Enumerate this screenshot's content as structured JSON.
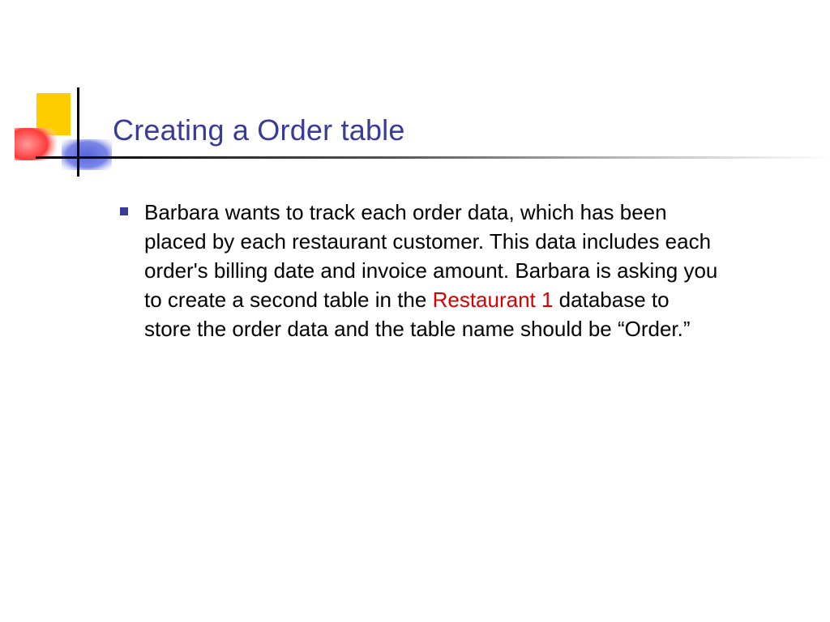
{
  "title": "Creating a Order table",
  "body": {
    "part1": "Barbara wants to track each order data, which has been placed by each restaurant customer. This data includes each order's billing date and invoice amount. Barbara is asking you to create a second table in the ",
    "emphasis": "Restaurant 1",
    "part2": " database to store the order data and the table name should be “Order.”"
  }
}
